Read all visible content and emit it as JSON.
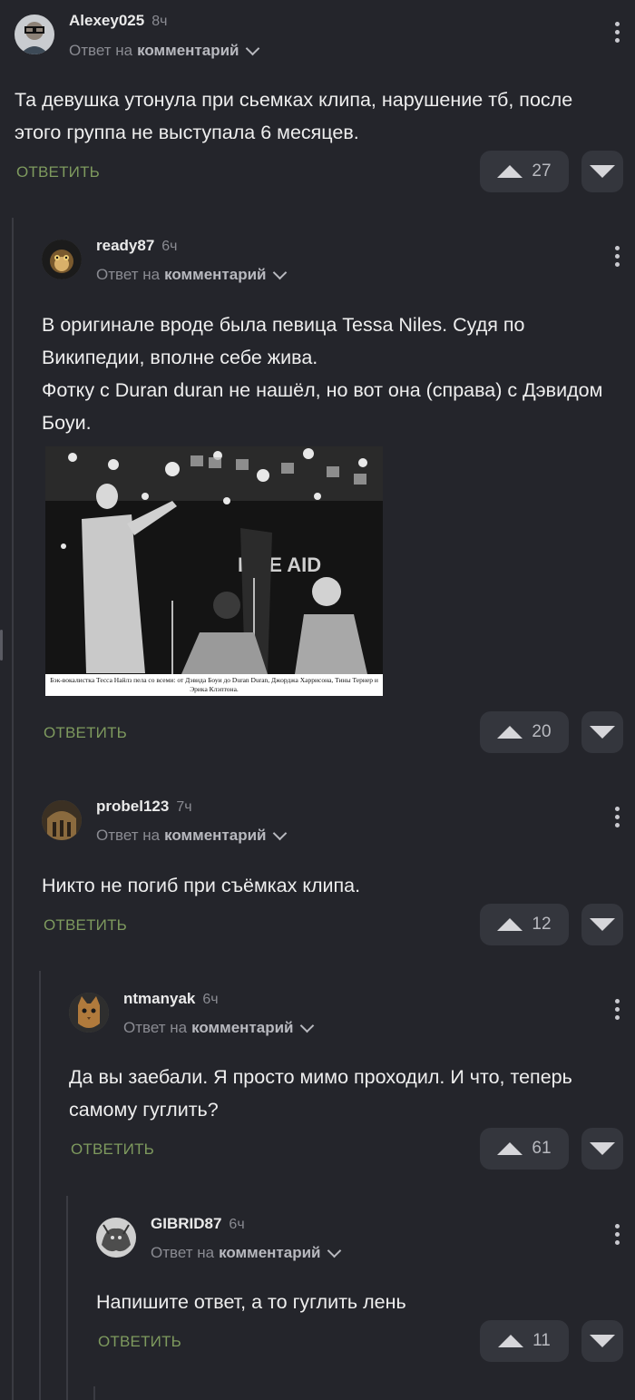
{
  "colors": {
    "background": "#24252b",
    "accent": "#7e9a5e",
    "button_bg": "#34363d"
  },
  "comments": [
    {
      "user": "Alexey025",
      "time": "8ч",
      "reply_prefix": "Ответ на",
      "reply_target": "комментарий",
      "text": [
        "Та девушка утонула при сьемках клипа, нарушение тб, после этого группа не выступала 6 месяцев."
      ],
      "reply_label": "ОТВЕТИТЬ",
      "votes": "27",
      "avatar_icon": "avatar-glasses-man-icon"
    },
    {
      "user": "ready87",
      "time": "6ч",
      "reply_prefix": "Ответ на",
      "reply_target": "комментарий",
      "text": [
        "В оригинале вроде была певица Tessa Niles. Судя по Википедии, вполне себе жива.",
        "Фотку с Duran duran не нашёл, но вот она (справа) с Дэвидом Боуи."
      ],
      "image_caption": "Бэк-вокалистка Тесса Найлз пела со всеми: от Дэвида Боуи до Duran Duran, Джорджа Харрисона, Тины Тернер и Эрика Клэптона.",
      "image_stage_text": "LIVE AID",
      "reply_label": "ОТВЕТИТЬ",
      "votes": "20",
      "avatar_icon": "avatar-monkey-icon"
    },
    {
      "user": "probel123",
      "time": "7ч",
      "reply_prefix": "Ответ на",
      "reply_target": "комментарий",
      "text": [
        "Никто не погиб при съёмках клипа."
      ],
      "reply_label": "ОТВЕТИТЬ",
      "votes": "12",
      "avatar_icon": "avatar-building-icon"
    },
    {
      "user": "ntmanyak",
      "time": "6ч",
      "reply_prefix": "Ответ на",
      "reply_target": "комментарий",
      "text": [
        "Да вы заебали. Я просто мимо проходил. И что, теперь самому гуглить?"
      ],
      "reply_label": "ОТВЕТИТЬ",
      "votes": "61",
      "avatar_icon": "avatar-cat-icon"
    },
    {
      "user": "GIBRID87",
      "time": "6ч",
      "reply_prefix": "Ответ на",
      "reply_target": "комментарий",
      "text": [
        "Напишите ответ, а то гуглить лень"
      ],
      "reply_label": "ОТВЕТИТЬ",
      "votes": "11",
      "avatar_icon": "avatar-creature-icon"
    }
  ]
}
